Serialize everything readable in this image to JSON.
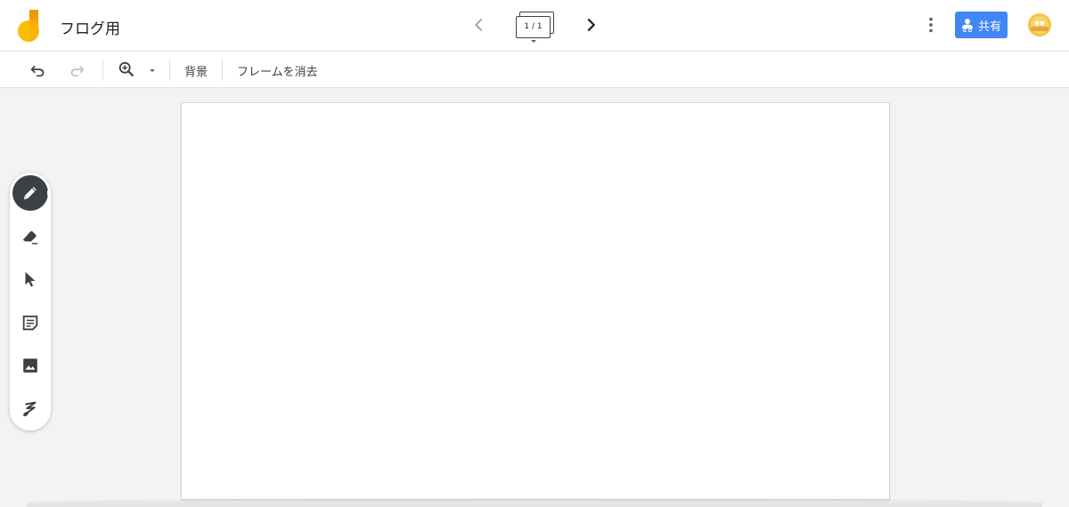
{
  "app": {
    "title": "フログ用",
    "brand_colors": {
      "yellow": "#fbbc04",
      "orange": "#f29900",
      "blue": "#4285f4"
    }
  },
  "header": {
    "frame_indicator": "1 / 1",
    "share_label": "共有",
    "icons": {
      "prev": "chevron-left-icon",
      "next": "chevron-right-icon",
      "more": "more-vert-icon",
      "share": "share-people-icon",
      "avatar": "avatar-icon"
    }
  },
  "toolbar": {
    "background_label": "背景",
    "clear_frame_label": "フレームを消去",
    "icons": [
      "undo-icon",
      "redo-icon",
      "zoom-in-icon",
      "chevron-down-icon"
    ]
  },
  "tools": [
    {
      "name": "pen",
      "icon": "pen-icon",
      "active": true
    },
    {
      "name": "eraser",
      "icon": "eraser-icon",
      "active": false
    },
    {
      "name": "select",
      "icon": "cursor-arrow-icon",
      "active": false
    },
    {
      "name": "sticky-note",
      "icon": "sticky-note-icon",
      "active": false
    },
    {
      "name": "image",
      "icon": "image-icon",
      "active": false
    },
    {
      "name": "laser",
      "icon": "laser-pointer-icon",
      "active": false
    }
  ]
}
